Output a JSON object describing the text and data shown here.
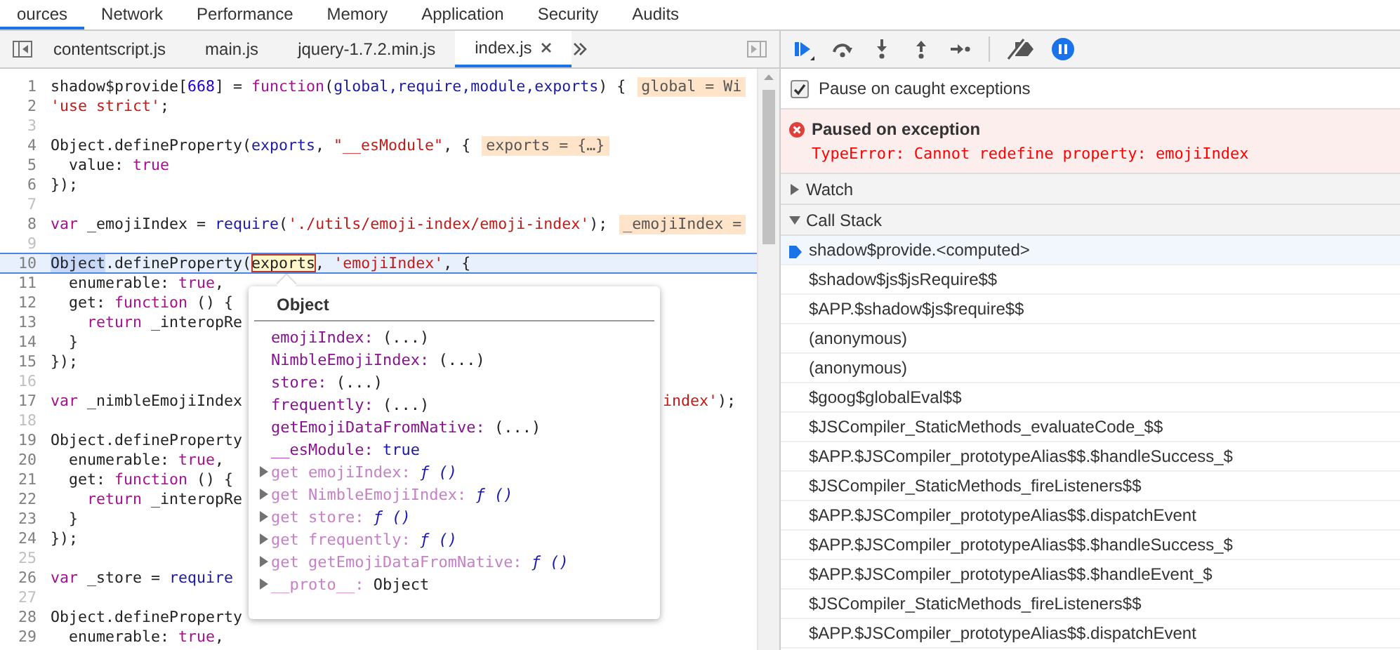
{
  "panel_tabs": [
    {
      "label": "ources",
      "selected": true
    },
    {
      "label": "Network",
      "selected": false
    },
    {
      "label": "Performance",
      "selected": false
    },
    {
      "label": "Memory",
      "selected": false
    },
    {
      "label": "Application",
      "selected": false
    },
    {
      "label": "Security",
      "selected": false
    },
    {
      "label": "Audits",
      "selected": false
    }
  ],
  "file_tabs": [
    {
      "label": "contentscript.js",
      "selected": false
    },
    {
      "label": "main.js",
      "selected": false
    },
    {
      "label": "jquery-1.7.2.min.js",
      "selected": false
    },
    {
      "label": "index.js",
      "selected": true
    }
  ],
  "editor": {
    "lines": [
      {
        "number": "1",
        "current": false,
        "parts": [
          {
            "kind": "plain",
            "text": "shadow$provide["
          },
          {
            "kind": "number",
            "text": "668"
          },
          {
            "kind": "plain",
            "text": "] = "
          },
          {
            "kind": "keyword",
            "text": "function"
          },
          {
            "kind": "plain",
            "text": "("
          },
          {
            "kind": "name",
            "text": "global,require,module,exports"
          },
          {
            "kind": "plain",
            "text": ") {"
          }
        ],
        "inline_value": "global = Wi"
      },
      {
        "number": "2",
        "current": false,
        "parts": [
          {
            "kind": "string",
            "text": "'use strict'"
          },
          {
            "kind": "plain",
            "text": ";"
          }
        ]
      },
      {
        "number": "3",
        "current": false
      },
      {
        "number": "4",
        "current": false,
        "parts": [
          {
            "kind": "plain",
            "text": "Object.defineProperty("
          },
          {
            "kind": "name",
            "text": "exports"
          },
          {
            "kind": "plain",
            "text": ", "
          },
          {
            "kind": "string",
            "text": "\"__esModule\""
          },
          {
            "kind": "plain",
            "text": ", {"
          }
        ],
        "inline_value": "exports = {…}"
      },
      {
        "number": "5",
        "current": false,
        "parts": [
          {
            "kind": "plain",
            "text": "  value: "
          },
          {
            "kind": "keyword",
            "text": "true"
          }
        ]
      },
      {
        "number": "6",
        "current": false,
        "parts": [
          {
            "kind": "plain",
            "text": "});"
          }
        ]
      },
      {
        "number": "7",
        "current": false
      },
      {
        "number": "8",
        "current": false,
        "parts": [
          {
            "kind": "keyword",
            "text": "var"
          },
          {
            "kind": "plain",
            "text": " _emojiIndex = "
          },
          {
            "kind": "name",
            "text": "require"
          },
          {
            "kind": "plain",
            "text": "("
          },
          {
            "kind": "string",
            "text": "'./utils/emoji-index/emoji-index'"
          },
          {
            "kind": "plain",
            "text": ");"
          }
        ],
        "inline_value": "_emojiIndex ="
      },
      {
        "number": "9",
        "current": false
      },
      {
        "number": "10",
        "current": true,
        "parts": [
          {
            "kind": "selection",
            "text": "Object"
          },
          {
            "kind": "plain",
            "text": ".defineProperty("
          },
          {
            "kind": "hover",
            "text": "exports"
          },
          {
            "kind": "plain",
            "text": ", "
          },
          {
            "kind": "string",
            "text": "'emojiIndex'"
          },
          {
            "kind": "plain",
            "text": ", {"
          }
        ]
      },
      {
        "number": "11",
        "current": false,
        "parts": [
          {
            "kind": "plain",
            "text": "  enumerable: "
          },
          {
            "kind": "keyword",
            "text": "true"
          },
          {
            "kind": "plain",
            "text": ","
          }
        ]
      },
      {
        "number": "12",
        "current": false,
        "parts": [
          {
            "kind": "plain",
            "text": "  get: "
          },
          {
            "kind": "keyword",
            "text": "function"
          },
          {
            "kind": "plain",
            "text": " () {"
          }
        ]
      },
      {
        "number": "13",
        "current": false,
        "parts": [
          {
            "kind": "keyword",
            "text": "    return"
          },
          {
            "kind": "plain",
            "text": " _interopRe"
          }
        ]
      },
      {
        "number": "14",
        "current": false,
        "parts": [
          {
            "kind": "plain",
            "text": "  }"
          }
        ]
      },
      {
        "number": "15",
        "current": false,
        "parts": [
          {
            "kind": "plain",
            "text": "});"
          }
        ]
      },
      {
        "number": "16",
        "current": false
      },
      {
        "number": "17",
        "current": false,
        "parts": [
          {
            "kind": "keyword",
            "text": "var"
          },
          {
            "kind": "plain",
            "text": " _nimbleEmojiIndex"
          }
        ],
        "tail": [
          {
            "kind": "string",
            "text": "index'"
          },
          {
            "kind": "plain",
            "text": ");"
          }
        ]
      },
      {
        "number": "18",
        "current": false
      },
      {
        "number": "19",
        "current": false,
        "parts": [
          {
            "kind": "plain",
            "text": "Object.defineProperty"
          }
        ]
      },
      {
        "number": "20",
        "current": false,
        "parts": [
          {
            "kind": "plain",
            "text": "  enumerable: "
          },
          {
            "kind": "keyword",
            "text": "true"
          },
          {
            "kind": "plain",
            "text": ","
          }
        ]
      },
      {
        "number": "21",
        "current": false,
        "parts": [
          {
            "kind": "plain",
            "text": "  get: "
          },
          {
            "kind": "keyword",
            "text": "function"
          },
          {
            "kind": "plain",
            "text": " () {"
          }
        ]
      },
      {
        "number": "22",
        "current": false,
        "parts": [
          {
            "kind": "keyword",
            "text": "    return"
          },
          {
            "kind": "plain",
            "text": " _interopRe"
          }
        ]
      },
      {
        "number": "23",
        "current": false,
        "parts": [
          {
            "kind": "plain",
            "text": "  }"
          }
        ]
      },
      {
        "number": "24",
        "current": false,
        "parts": [
          {
            "kind": "plain",
            "text": "});"
          }
        ]
      },
      {
        "number": "25",
        "current": false
      },
      {
        "number": "26",
        "current": false,
        "parts": [
          {
            "kind": "keyword",
            "text": "var"
          },
          {
            "kind": "plain",
            "text": " _store = "
          },
          {
            "kind": "name",
            "text": "require"
          }
        ]
      },
      {
        "number": "27",
        "current": false
      },
      {
        "number": "28",
        "current": false,
        "parts": [
          {
            "kind": "plain",
            "text": "Object.defineProperty"
          }
        ]
      },
      {
        "number": "29",
        "current": false,
        "parts": [
          {
            "kind": "plain",
            "text": "  enumerable: "
          },
          {
            "kind": "keyword",
            "text": "true"
          },
          {
            "kind": "plain",
            "text": ","
          }
        ]
      }
    ],
    "popover": {
      "title": "Object",
      "properties": [
        {
          "kind": "lazy",
          "name": "emojiIndex:",
          "value": "(...)",
          "expandable": false
        },
        {
          "kind": "lazy",
          "name": "NimbleEmojiIndex:",
          "value": "(...)",
          "expandable": false
        },
        {
          "kind": "lazy",
          "name": "store:",
          "value": "(...)",
          "expandable": false
        },
        {
          "kind": "lazy",
          "name": "frequently:",
          "value": "(...)",
          "expandable": false
        },
        {
          "kind": "lazy",
          "name": "getEmojiDataFromNative:",
          "value": "(...)",
          "expandable": false
        },
        {
          "kind": "boolean",
          "name": "__esModule:",
          "value": "true",
          "expandable": false
        },
        {
          "kind": "getter",
          "name": "get emojiIndex:",
          "value": "ƒ ()",
          "expandable": true
        },
        {
          "kind": "getter",
          "name": "get NimbleEmojiIndex:",
          "value": "ƒ ()",
          "expandable": true
        },
        {
          "kind": "getter",
          "name": "get store:",
          "value": "ƒ ()",
          "expandable": true
        },
        {
          "kind": "getter",
          "name": "get frequently:",
          "value": "ƒ ()",
          "expandable": true
        },
        {
          "kind": "getter",
          "name": "get getEmojiDataFromNative:",
          "value": "ƒ ()",
          "expandable": true
        },
        {
          "kind": "proto",
          "name": "__proto__:",
          "value": "Object",
          "expandable": true
        }
      ]
    }
  },
  "debugger": {
    "pause_on_exceptions": true,
    "checkbox": {
      "label": "Pause on caught exceptions",
      "checked": true
    },
    "exception": {
      "title": "Paused on exception",
      "message": "TypeError: Cannot redefine property: emojiIndex"
    },
    "sections": [
      {
        "title": "Watch",
        "expanded": false
      },
      {
        "title": "Call Stack",
        "expanded": true,
        "frames": [
          {
            "name": "shadow$provide.<computed>",
            "selected": true
          },
          {
            "name": "$shadow$js$jsRequire$$",
            "selected": false
          },
          {
            "name": "$APP.$shadow$js$require$$",
            "selected": false
          },
          {
            "name": "(anonymous)",
            "selected": false
          },
          {
            "name": "(anonymous)",
            "selected": false
          },
          {
            "name": "$goog$globalEval$$",
            "selected": false
          },
          {
            "name": "$JSCompiler_StaticMethods_evaluateCode_$$",
            "selected": false
          },
          {
            "name": "$APP.$JSCompiler_prototypeAlias$$.$handleSuccess_$",
            "selected": false
          },
          {
            "name": "$JSCompiler_StaticMethods_fireListeners$$",
            "selected": false
          },
          {
            "name": "$APP.$JSCompiler_prototypeAlias$$.dispatchEvent",
            "selected": false
          },
          {
            "name": "$APP.$JSCompiler_prototypeAlias$$.$handleSuccess_$",
            "selected": false
          },
          {
            "name": "$APP.$JSCompiler_prototypeAlias$$.$handleEvent_$",
            "selected": false
          },
          {
            "name": "$JSCompiler_StaticMethods_fireListeners$$",
            "selected": false
          },
          {
            "name": "$APP.$JSCompiler_prototypeAlias$$.dispatchEvent",
            "selected": false
          }
        ]
      }
    ]
  }
}
